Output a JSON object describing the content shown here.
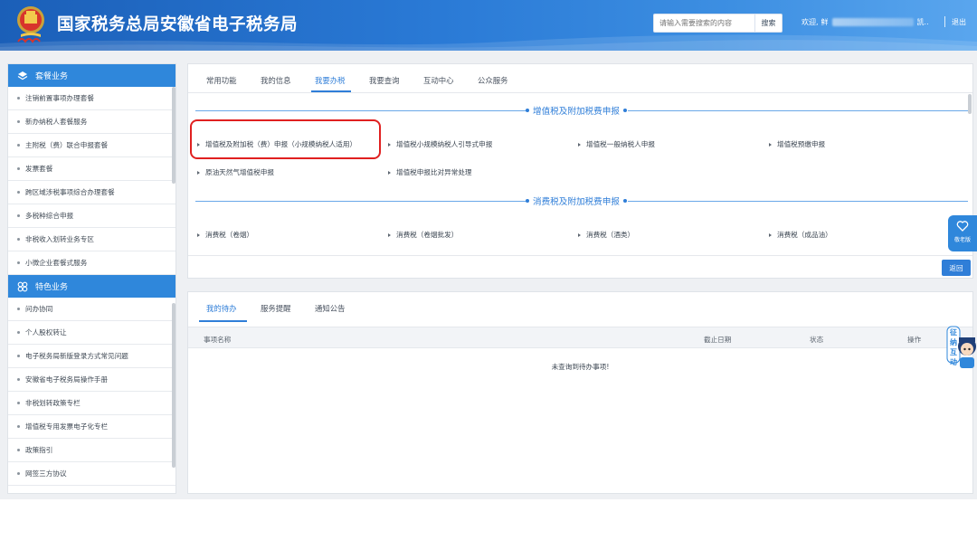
{
  "header": {
    "title": "国家税务总局安徽省电子税务局",
    "search_placeholder": "请输入需要搜索的内容",
    "search_button": "搜索",
    "welcome_prefix": "欢迎,",
    "welcome_name_start": "鲜",
    "welcome_suffix": "凯..",
    "logout": "退出"
  },
  "sidebar": {
    "section1": {
      "title": "套餐业务",
      "items": [
        "注销前置事项办理套餐",
        "新办纳税人套餐服务",
        "主附税（费）联合申报套餐",
        "发票套餐",
        "跨区域涉税事项综合办理套餐",
        "多税种综合申报",
        "非税收入划转业务专区",
        "小微企业套餐式服务"
      ]
    },
    "section2": {
      "title": "特色业务",
      "items": [
        "问办协同",
        "个人股权转让",
        "电子税务局新版登录方式常见问题",
        "安徽省电子税务局操作手册",
        "非税划转政策专栏",
        "增值税专用发票电子化专栏",
        "政策指引",
        "网签三方协议"
      ]
    }
  },
  "main": {
    "tabs": [
      "常用功能",
      "我的信息",
      "我要办税",
      "我要查询",
      "互动中心",
      "公众服务"
    ],
    "active_tab_index": 2,
    "sections": [
      {
        "title": "增值税及附加税费申报",
        "links": [
          "增值税及附加税（费）申报（小规模纳税人适用）",
          "增值税小规模纳税人引导式申报",
          "增值税一般纳税人申报",
          "增值税预缴申报",
          "原油天然气增值税申报",
          "增值税申报比对异常处理"
        ]
      },
      {
        "title": "消费税及附加税费申报",
        "links": [
          "消费税（卷烟）",
          "消费税（卷烟批发）",
          "消费税（酒类）",
          "消费税（成品油）"
        ]
      }
    ],
    "back_button": "返回"
  },
  "todo": {
    "tabs": [
      "我的待办",
      "服务提醒",
      "通知公告"
    ],
    "active_tab_index": 0,
    "columns": [
      "事项名称",
      "截止日期",
      "状态",
      "操作"
    ],
    "empty_message": "未查询到待办事项!"
  },
  "floating": {
    "card_label": "敬老版",
    "mascot_text": "征纳互动"
  },
  "colors": {
    "brand_blue": "#2f7ed8",
    "header_start": "#1b5fb8",
    "highlight_red": "#e02020"
  }
}
